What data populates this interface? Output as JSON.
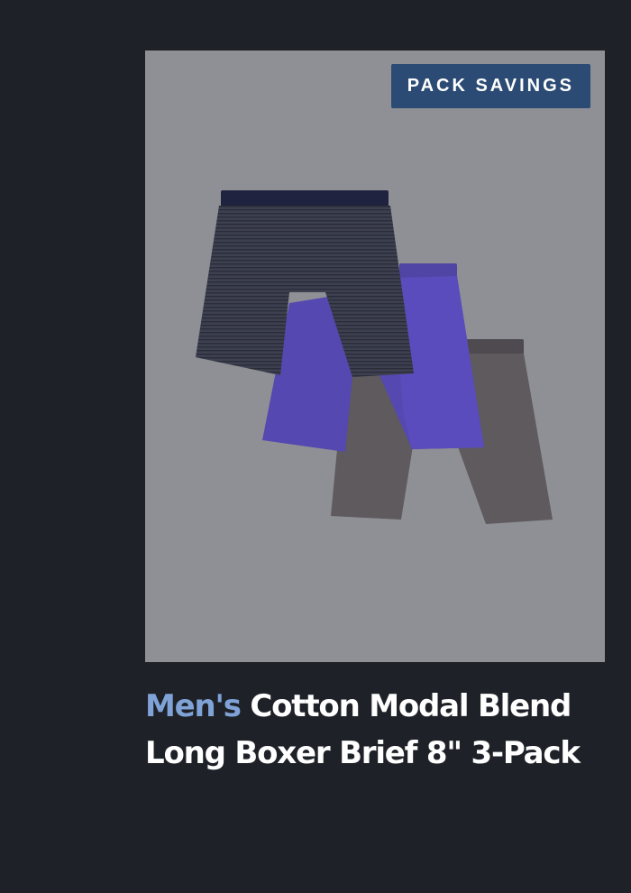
{
  "product": {
    "badge": "PACK SAVINGS",
    "gender_label": "Men's",
    "name": "Cotton Modal Blend Long Boxer Brief 8\" 3-Pack",
    "image_alt": "Three long boxer briefs: navy stripe, purple, and charcoal grey",
    "colors": {
      "page_background": "#1e2228",
      "image_background": "#8f9095",
      "badge_background": "#2b4b74",
      "gender_accent": "#7fa3d6",
      "brief_navy_stripe": "#3a3e4e",
      "brief_purple": "#5548b0",
      "brief_charcoal": "#5e5a5e"
    }
  }
}
